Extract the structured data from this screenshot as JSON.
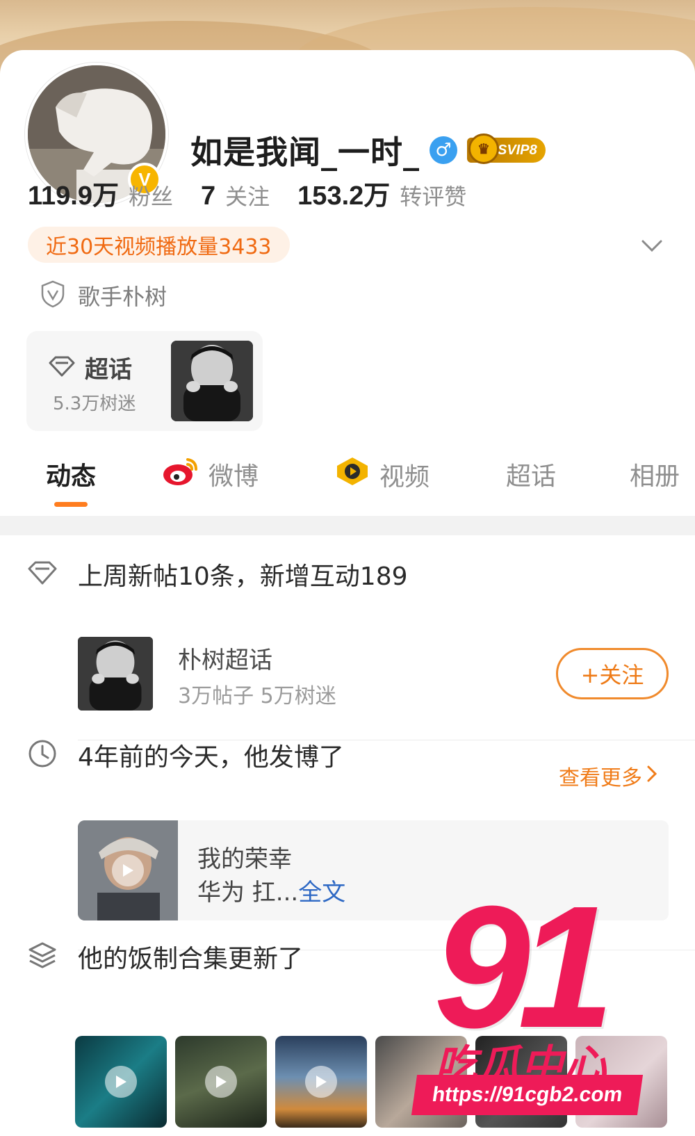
{
  "profile": {
    "username": "如是我闻_一时_",
    "gender_symbol": "♂",
    "svip_label": "SVIP8",
    "verified_mark": "V",
    "stats": [
      {
        "num": "119.9万",
        "label": "粉丝"
      },
      {
        "num": "7",
        "label": "关注"
      },
      {
        "num": "153.2万",
        "label": "转评赞"
      }
    ],
    "video_plays": "近30天视频播放量3433",
    "identity": "歌手朴树"
  },
  "supertopic_card": {
    "title": "超话",
    "subtitle": "5.3万树迷"
  },
  "tabs": [
    {
      "label": "动态",
      "icon": ""
    },
    {
      "label": "微博",
      "icon": "weibo-icon"
    },
    {
      "label": "视频",
      "icon": "video-icon"
    },
    {
      "label": "超话",
      "icon": ""
    },
    {
      "label": "相册",
      "icon": ""
    }
  ],
  "weekly": {
    "title": "上周新帖10条，新增互动189",
    "topic_name": "朴树超话",
    "topic_meta": "3万帖子 5万树迷",
    "follow_label": "+关注"
  },
  "memory": {
    "title": "4年前的今天，他发博了",
    "see_more": "查看更多",
    "line1": "我的荣幸",
    "line2": "华为 扛...",
    "full_text": "全文"
  },
  "collection": {
    "title": "他的饭制合集更新了"
  },
  "watermark": {
    "number": "91",
    "name": "吃瓜中心",
    "url": "https://91cgb2.com"
  },
  "colors": {
    "accent_orange": "#f07c19",
    "watermark_pink": "#ee1b58",
    "link_blue": "#2d68c4"
  }
}
